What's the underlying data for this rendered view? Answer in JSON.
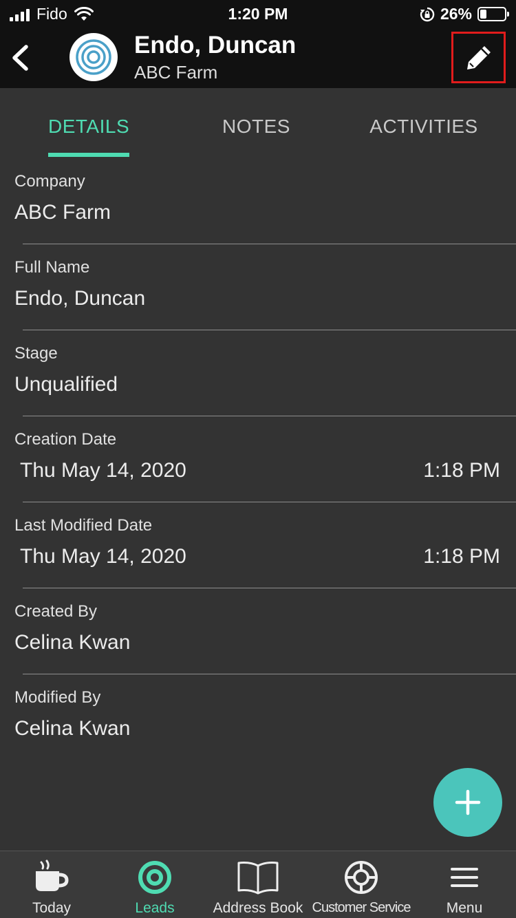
{
  "status_bar": {
    "carrier": "Fido",
    "time": "1:20 PM",
    "battery": "26%",
    "battery_level": 0.26
  },
  "header": {
    "title": "Endo, Duncan",
    "subtitle": "ABC Farm",
    "back_icon": "chevron-left-icon",
    "edit_icon": "pencil-icon",
    "avatar_icon": "target-icon"
  },
  "tabs": [
    {
      "label": "DETAILS",
      "active": true
    },
    {
      "label": "NOTES",
      "active": false
    },
    {
      "label": "ACTIVITIES",
      "active": false
    }
  ],
  "fields": [
    {
      "label": "Company",
      "value": "ABC Farm"
    },
    {
      "label": "Full Name",
      "value": "Endo, Duncan"
    },
    {
      "label": "Stage",
      "value": "Unqualified"
    },
    {
      "label": "Creation Date",
      "value": "Thu May 14, 2020",
      "time": "1:18 PM"
    },
    {
      "label": "Last Modified Date",
      "value": "Thu May 14, 2020",
      "time": "1:18 PM"
    },
    {
      "label": "Created By",
      "value": "Celina Kwan"
    },
    {
      "label": "Modified By",
      "value": "Celina Kwan"
    }
  ],
  "fab": {
    "icon": "plus-icon"
  },
  "bottom_nav": [
    {
      "label": "Today",
      "icon": "coffee-cup-icon",
      "active": false
    },
    {
      "label": "Leads",
      "icon": "target-icon",
      "active": true
    },
    {
      "label": "Address Book",
      "icon": "open-book-icon",
      "active": false
    },
    {
      "label": "Customer Service",
      "icon": "lifebuoy-icon",
      "active": false
    },
    {
      "label": "Menu",
      "icon": "hamburger-menu-icon",
      "active": false
    }
  ],
  "colors": {
    "accent": "#4fdcb2",
    "fab": "#4bc5bb",
    "header_bg": "#111111",
    "body_bg": "#333333",
    "highlight_border": "#e11c1c"
  }
}
